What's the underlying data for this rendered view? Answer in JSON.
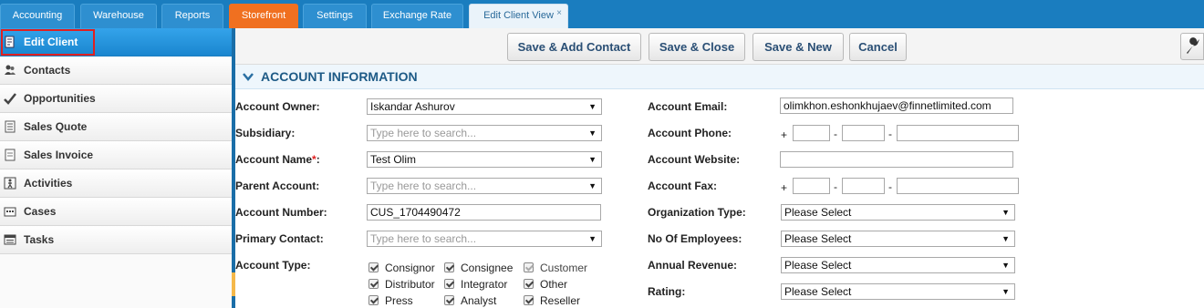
{
  "tabs": [
    {
      "label": "Accounting",
      "style": "normal"
    },
    {
      "label": "Warehouse",
      "style": "normal"
    },
    {
      "label": "Reports",
      "style": "normal"
    },
    {
      "label": "Storefront",
      "style": "orange"
    },
    {
      "label": "Settings",
      "style": "normal"
    },
    {
      "label": "Exchange Rate",
      "style": "normal"
    },
    {
      "label": "Edit Client View",
      "style": "active",
      "close": "×"
    }
  ],
  "sidebar": {
    "items": [
      {
        "label": "Edit Client",
        "icon": "edit-document-icon",
        "active": true
      },
      {
        "label": "Contacts",
        "icon": "contacts-icon"
      },
      {
        "label": "Opportunities",
        "icon": "checkmark-icon"
      },
      {
        "label": "Sales Quote",
        "icon": "quote-document-icon"
      },
      {
        "label": "Sales Invoice",
        "icon": "invoice-document-icon"
      },
      {
        "label": "Activities",
        "icon": "activities-icon"
      },
      {
        "label": "Cases",
        "icon": "cases-icon"
      },
      {
        "label": "Tasks",
        "icon": "tasks-icon"
      }
    ]
  },
  "toolbar": {
    "save_add_contact": "Save & Add Contact",
    "save_close": "Save & Close",
    "save_new": "Save & New",
    "cancel": "Cancel",
    "settings_icon": "wrench-icon"
  },
  "section": {
    "title": "ACCOUNT INFORMATION"
  },
  "form": {
    "account_owner": {
      "label": "Account Owner:",
      "value": "Iskandar Ashurov"
    },
    "subsidiary": {
      "label": "Subsidiary:",
      "placeholder": "Type here to search..."
    },
    "account_name": {
      "label": "Account Name",
      "required": "*",
      "colon": ":",
      "value": "Test Olim"
    },
    "parent_account": {
      "label": "Parent Account:",
      "placeholder": "Type here to search..."
    },
    "account_number": {
      "label": "Account Number:",
      "value": "CUS_1704490472"
    },
    "primary_contact": {
      "label": "Primary Contact:",
      "placeholder": "Type here to search..."
    },
    "account_type": {
      "label": "Account Type:",
      "options": [
        {
          "label": "Consignor",
          "checked": true
        },
        {
          "label": "Consignee",
          "checked": true
        },
        {
          "label": "Customer",
          "checked": true,
          "disabled": true
        },
        {
          "label": "Distributor",
          "checked": true
        },
        {
          "label": "Integrator",
          "checked": true
        },
        {
          "label": "Other",
          "checked": true
        },
        {
          "label": "Press",
          "checked": true
        },
        {
          "label": "Analyst",
          "checked": true
        },
        {
          "label": "Reseller",
          "checked": true
        }
      ]
    },
    "account_email": {
      "label": "Account Email:",
      "value": "olimkhon.eshonkhujaev@finnetlimited.com"
    },
    "account_phone": {
      "label": "Account Phone:",
      "plus": "+",
      "dash": "-"
    },
    "account_website": {
      "label": "Account Website:",
      "value": ""
    },
    "account_fax": {
      "label": "Account Fax:",
      "plus": "+",
      "dash": "-"
    },
    "organization_type": {
      "label": "Organization Type:",
      "value": "Please Select"
    },
    "no_of_employees": {
      "label": "No Of Employees:",
      "value": "Please Select"
    },
    "annual_revenue": {
      "label": "Annual Revenue:",
      "value": "Please Select"
    },
    "rating": {
      "label": "Rating:",
      "value": "Please Select"
    }
  },
  "colors": {
    "topbar": "#1a7dbf",
    "active_sidebar": "#1a86cf",
    "orange_tab": "#f07020",
    "section_title": "#1d5a86"
  }
}
